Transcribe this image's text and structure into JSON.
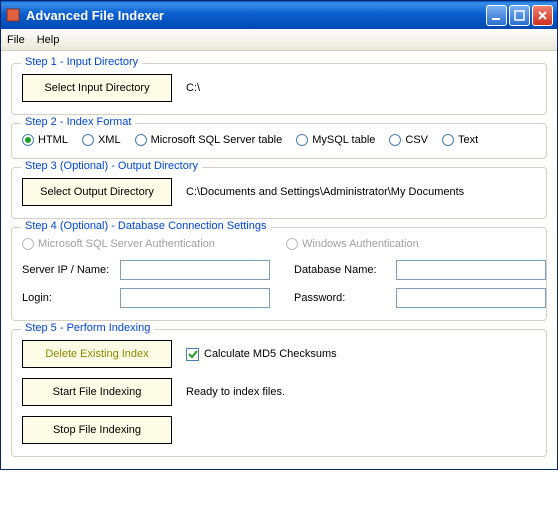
{
  "window": {
    "title": "Advanced File Indexer"
  },
  "menu": {
    "file": "File",
    "help": "Help"
  },
  "step1": {
    "title": "Step 1 - Input Directory",
    "button": "Select Input Directory",
    "path": "C:\\"
  },
  "step2": {
    "title": "Step 2 - Index Format",
    "opts": {
      "html": "HTML",
      "xml": "XML",
      "mssql": "Microsoft SQL Server table",
      "mysql": "MySQL table",
      "csv": "CSV",
      "text": "Text"
    }
  },
  "step3": {
    "title": "Step 3 (Optional) - Output Directory",
    "button": "Select Output Directory",
    "path": "C:\\Documents and Settings\\Administrator\\My Documents"
  },
  "step4": {
    "title": "Step 4 (Optional) - Database Connection Settings",
    "auth_sql": "Microsoft SQL Server Authentication",
    "auth_win": "Windows Authentication",
    "server_label": "Server IP / Name:",
    "dbname_label": "Database Name:",
    "login_label": "Login:",
    "password_label": "Password:",
    "server": "",
    "dbname": "",
    "login": "",
    "password": ""
  },
  "step5": {
    "title": "Step 5 - Perform Indexing",
    "delete_btn": "Delete Existing Index",
    "md5_label": "Calculate MD5 Checksums",
    "start_btn": "Start File Indexing",
    "status": "Ready to index files.",
    "stop_btn": "Stop File Indexing"
  }
}
